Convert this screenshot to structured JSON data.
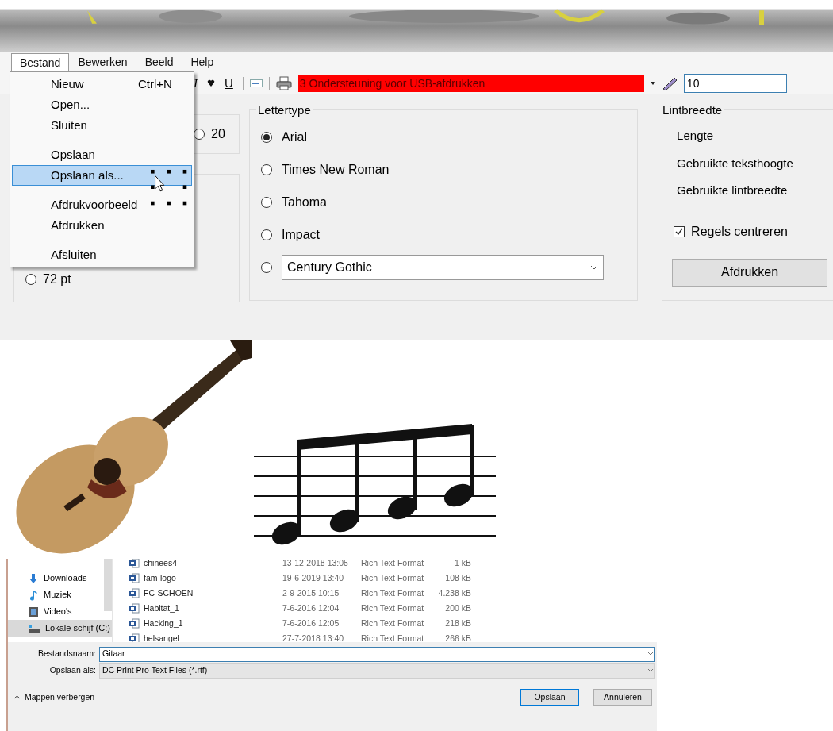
{
  "menubar": [
    {
      "label": "Bestand",
      "selected": true
    },
    {
      "label": "Bewerken",
      "selected": false
    },
    {
      "label": "Beeld",
      "selected": false
    },
    {
      "label": "Help",
      "selected": false
    }
  ],
  "file_menu": [
    {
      "kind": "item",
      "label": "Nieuw",
      "shortcut": "Ctrl+N",
      "selected": false
    },
    {
      "kind": "item",
      "label": "Open...",
      "selected": false
    },
    {
      "kind": "item",
      "label": "Sluiten",
      "selected": false
    },
    {
      "kind": "separator"
    },
    {
      "kind": "item",
      "label": "Opslaan",
      "selected": false
    },
    {
      "kind": "item",
      "label": "Opslaan als...",
      "selected": true
    },
    {
      "kind": "separator"
    },
    {
      "kind": "item",
      "label": "Afdrukvoorbeeld",
      "selected": false
    },
    {
      "kind": "item",
      "label": "Afdrukken",
      "selected": false
    },
    {
      "kind": "separator"
    },
    {
      "kind": "item",
      "label": "Afsluiten",
      "selected": false
    }
  ],
  "toolbar": {
    "italic": "I",
    "underline": "U",
    "printer": "3 Ondersteuning voor USB-afdrukken",
    "size": "10"
  },
  "size_group_1": [
    {
      "label": "20",
      "selected": false
    }
  ],
  "size_group_2": [
    {
      "label": "72 pt",
      "selected": false
    }
  ],
  "font_group": {
    "title": "Lettertype",
    "options": [
      {
        "kind": "radio",
        "label": "Arial",
        "selected": true
      },
      {
        "kind": "radio",
        "label": "Times New Roman",
        "selected": false
      },
      {
        "kind": "radio",
        "label": "Tahoma",
        "selected": false
      },
      {
        "kind": "radio",
        "label": "Impact",
        "selected": false
      },
      {
        "kind": "combo",
        "label": "Century Gothic",
        "selected": false
      }
    ]
  },
  "ribbon_group": {
    "title": "Lintbreedte",
    "labels": [
      "Lengte",
      "Gebruikte teksthoogte",
      "Gebruikte lintbreedte"
    ],
    "checkbox": {
      "label": "Regels centreren",
      "checked": true
    },
    "button": "Afdrukken"
  },
  "file_dialog": {
    "nav": [
      {
        "kind": "downloads",
        "label": "Downloads",
        "selected": false
      },
      {
        "kind": "music",
        "label": "Muziek",
        "selected": false
      },
      {
        "kind": "video",
        "label": "Video's",
        "selected": false
      },
      {
        "kind": "drive",
        "label": "Lokale schijf (C:)",
        "selected": true
      }
    ],
    "files": [
      {
        "name": "chinees4",
        "date": "13-12-2018 13:05",
        "type": "Rich Text Format",
        "size": "1 kB"
      },
      {
        "name": "fam-logo",
        "date": "19-6-2019 13:40",
        "type": "Rich Text Format",
        "size": "108 kB"
      },
      {
        "name": "FC-SCHOEN",
        "date": "2-9-2015 10:15",
        "type": "Rich Text Format",
        "size": "4.238 kB"
      },
      {
        "name": "Habitat_1",
        "date": "7-6-2016 12:04",
        "type": "Rich Text Format",
        "size": "200 kB"
      },
      {
        "name": "Hacking_1",
        "date": "7-6-2016 12:05",
        "type": "Rich Text Format",
        "size": "218 kB"
      },
      {
        "name": "helsangel",
        "date": "27-7-2018 13:40",
        "type": "Rich Text Format",
        "size": "266 kB"
      }
    ],
    "filename_label": "Bestandsnaam:",
    "filename_value": "Gitaar",
    "type_label": "Opslaan als:",
    "type_value": "DC Print Pro Text Files (*.rtf)",
    "hide_folders": "Mappen verbergen",
    "buttons": [
      "Opslaan",
      "Annuleren"
    ]
  }
}
